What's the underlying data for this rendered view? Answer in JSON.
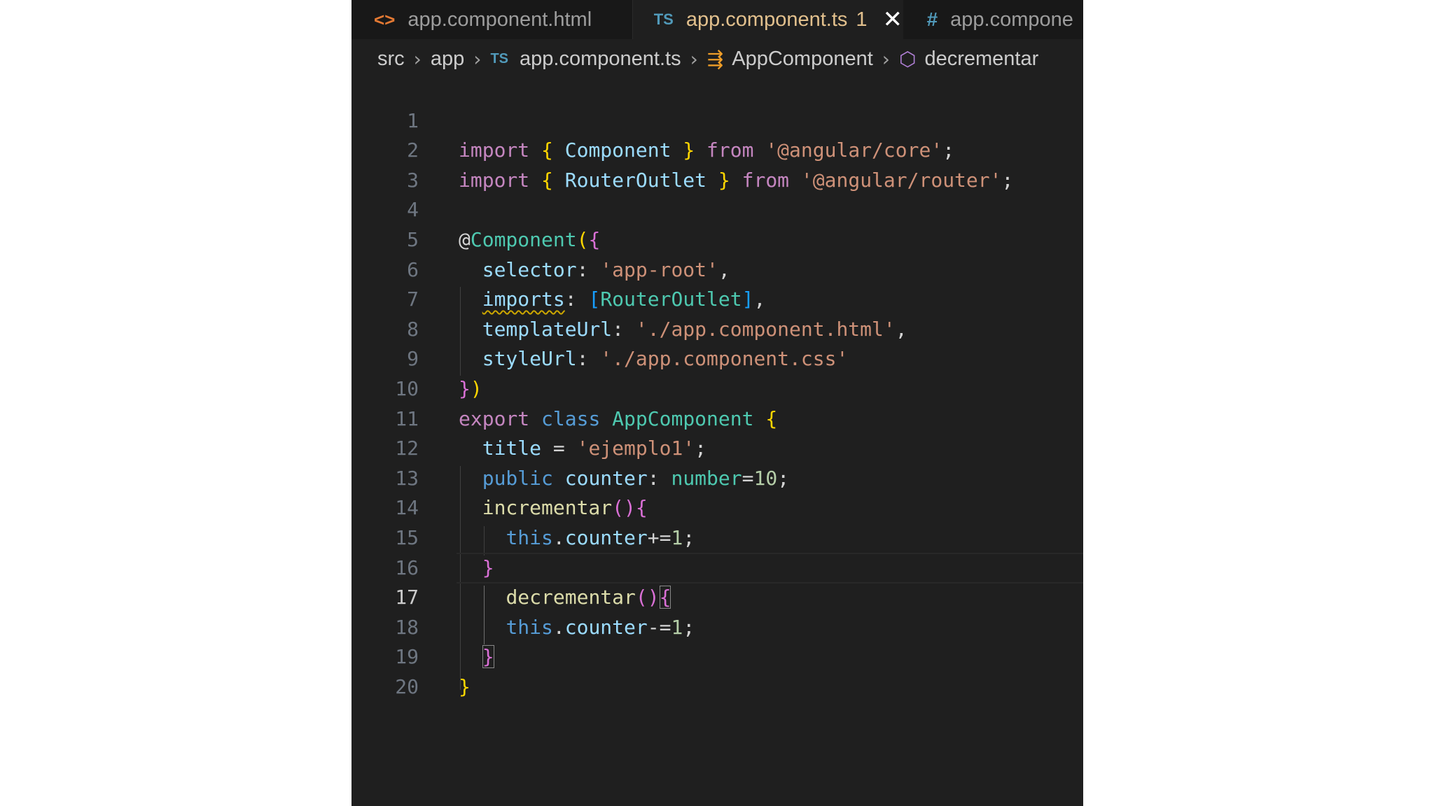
{
  "tabs": [
    {
      "icon": "html-file-icon",
      "icon_glyph": "<>",
      "label": "app.component.html"
    },
    {
      "icon": "typescript-file-icon",
      "icon_glyph": "TS",
      "label": "app.component.ts",
      "badge": "1",
      "active": true
    },
    {
      "icon": "css-file-icon",
      "icon_glyph": "#",
      "label": "app.compone"
    }
  ],
  "breadcrumb": {
    "items": [
      "src",
      "app",
      "app.component.ts",
      "AppComponent",
      "decrementar"
    ],
    "ts_glyph": "TS"
  },
  "editor": {
    "current_line": 17,
    "line_numbers": [
      "1",
      "2",
      "3",
      "4",
      "5",
      "6",
      "7",
      "8",
      "9",
      "10",
      "11",
      "12",
      "13",
      "14",
      "15",
      "16",
      "17",
      "18",
      "19",
      "20"
    ],
    "tokens": {
      "import": "import",
      "from": "from",
      "component": "Component",
      "angular_core": "'@angular/core'",
      "router_outlet": "RouterOutlet",
      "angular_router": "'@angular/router'",
      "at": "@",
      "selector": "selector",
      "app_root": "'app-root'",
      "imports": "imports",
      "template_url": "templateUrl",
      "template_path": "'./app.component.html'",
      "style_url": "styleUrl",
      "style_path": "'./app.component.css'",
      "export": "export",
      "class": "class",
      "app_component": "AppComponent",
      "title": "title",
      "title_value": "'ejemplo1'",
      "public": "public",
      "counter": "counter",
      "number": "number",
      "ten": "10",
      "incrementar": "incrementar",
      "decrementar": "decrementar",
      "this": "this",
      "one": "1"
    }
  },
  "colors": {
    "background": "#1f1f1f",
    "keyword": "#c586c0",
    "storage": "#569cd6",
    "string": "#ce9178",
    "type": "#4ec9b0",
    "function": "#dcdcaa",
    "variable": "#9cdcfe",
    "number": "#b5cea8",
    "bracket_level1": "#ffd700",
    "bracket_level2": "#da70d6",
    "bracket_level3": "#179fff",
    "modified_tab": "#e2c08d"
  }
}
